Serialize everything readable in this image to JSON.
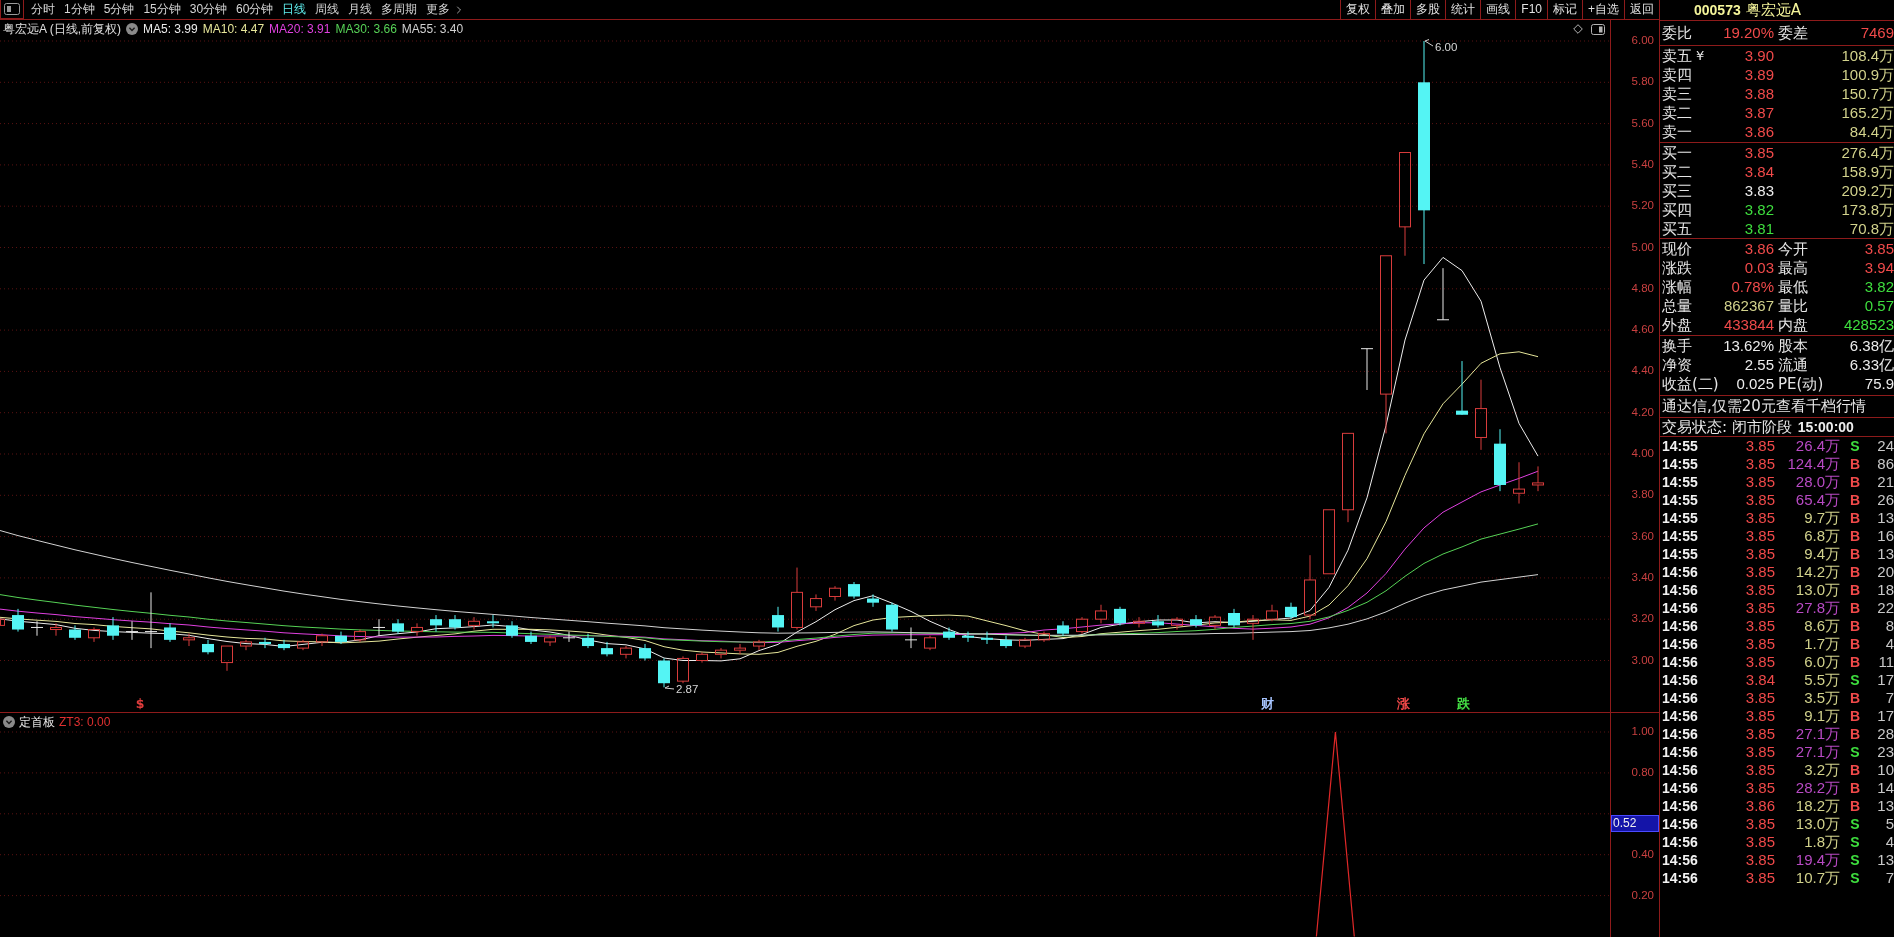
{
  "toolbar": {
    "periods": [
      {
        "label": "分时",
        "selected": false
      },
      {
        "label": "1分钟",
        "selected": false
      },
      {
        "label": "5分钟",
        "selected": false
      },
      {
        "label": "15分钟",
        "selected": false
      },
      {
        "label": "30分钟",
        "selected": false
      },
      {
        "label": "60分钟",
        "selected": false
      },
      {
        "label": "日线",
        "selected": true
      },
      {
        "label": "周线",
        "selected": false
      },
      {
        "label": "月线",
        "selected": false
      },
      {
        "label": "多周期",
        "selected": false
      }
    ],
    "more": {
      "label": "更多"
    },
    "tools": [
      "复权",
      "叠加",
      "多股",
      "统计",
      "画线",
      "F10",
      "标记",
      "+自选",
      "返回"
    ]
  },
  "chart": {
    "title": "粤宏远A (日线,前复权)",
    "moving_averages": [
      {
        "label": "MA5: 3.99",
        "color": "#ececec"
      },
      {
        "label": "MA10: 4.47",
        "color": "#e6e69a"
      },
      {
        "label": "MA20: 3.91",
        "color": "#e040e0"
      },
      {
        "label": "MA30: 3.66",
        "color": "#56d256"
      },
      {
        "label": "MA55: 3.40",
        "color": "#d2d2d2"
      }
    ],
    "price_axis": [
      "6.00",
      "5.80",
      "5.60",
      "5.40",
      "5.20",
      "5.00",
      "4.80",
      "4.60",
      "4.40",
      "4.20",
      "4.00",
      "3.80",
      "3.60",
      "3.40",
      "3.20",
      "3.00"
    ],
    "high_label": "6.00",
    "low_label": "2.87",
    "signals": [
      {
        "label": "$",
        "color": "#e03c3c"
      },
      {
        "label": "财",
        "color": "#a6c4ff"
      },
      {
        "label": "涨",
        "color": "#f04848"
      },
      {
        "label": "跌",
        "color": "#44e044"
      }
    ]
  },
  "indicator": {
    "name": "定首板",
    "reading": "ZT3: 0.00",
    "cursor_value": "0.52",
    "chart_data": {
      "type": "line",
      "categories": [
        null,
        null,
        null,
        null,
        null,
        null,
        null,
        null,
        null,
        null,
        null,
        null,
        null,
        null,
        null,
        null,
        null,
        null,
        null,
        null,
        null,
        null,
        null,
        null,
        null,
        null,
        null,
        null,
        null,
        null,
        null,
        null,
        null,
        null,
        null,
        null,
        null,
        null,
        null,
        null,
        null,
        null,
        null,
        null,
        null,
        null,
        null,
        null,
        null,
        null,
        null,
        null,
        null,
        null,
        null,
        null,
        null,
        null,
        null,
        null,
        null,
        null,
        null,
        null,
        null,
        null,
        null,
        null,
        null,
        null,
        null,
        null,
        null,
        null,
        null,
        null,
        null,
        null,
        null,
        null,
        null,
        null,
        null,
        null,
        null
      ],
      "series": [
        {
          "color": "#e02828",
          "values": [
            null,
            null,
            null,
            null,
            null,
            null,
            null,
            null,
            null,
            null,
            null,
            null,
            null,
            null,
            null,
            null,
            null,
            null,
            null,
            null,
            null,
            null,
            null,
            null,
            null,
            null,
            null,
            null,
            null,
            null,
            null,
            null,
            null,
            null,
            null,
            null,
            null,
            null,
            null,
            null,
            null,
            null,
            null,
            null,
            null,
            null,
            null,
            null,
            null,
            null,
            null,
            null,
            null,
            null,
            null,
            null,
            null,
            null,
            null,
            null,
            null,
            null,
            null,
            null,
            null,
            null,
            null,
            null,
            null,
            0,
            1,
            0,
            null,
            null,
            null,
            null,
            null,
            null,
            null,
            null,
            null,
            null,
            null,
            null,
            null
          ]
        }
      ],
      "ylim": [
        0,
        1
      ],
      "yticks": [
        {
          "value": 1,
          "label": "1.00"
        },
        {
          "value": 0.8,
          "label": "0.80"
        },
        {
          "value": 0.4,
          "label": "0.40"
        },
        {
          "value": 0.2,
          "label": "0.20"
        }
      ],
      "grid": true
    }
  },
  "quote": {
    "code": "000573",
    "name": "粤宏远A",
    "order_ratio": [
      {
        "label": "委比",
        "value": "19.20%",
        "color": "#f04a4a"
      },
      {
        "label": "委差",
        "value": "7469",
        "color": "#f04a4a"
      }
    ],
    "asks": [
      {
        "label": "卖五",
        "tag": "¥",
        "price": "3.90",
        "color": "#f04a4a",
        "volume": "108.4万"
      },
      {
        "label": "卖四",
        "price": "3.89",
        "color": "#f04a4a",
        "volume": "100.9万"
      },
      {
        "label": "卖三",
        "price": "3.88",
        "color": "#f04a4a",
        "volume": "150.7万"
      },
      {
        "label": "卖二",
        "price": "3.87",
        "color": "#f04a4a",
        "volume": "165.2万"
      },
      {
        "label": "卖一",
        "price": "3.86",
        "color": "#f04a4a",
        "volume": "84.4万"
      }
    ],
    "bids": [
      {
        "label": "买一",
        "price": "3.85",
        "color": "#f04a4a",
        "volume": "276.4万"
      },
      {
        "label": "买二",
        "price": "3.84",
        "color": "#f04a4a",
        "volume": "158.9万"
      },
      {
        "label": "买三",
        "price": "3.83",
        "color": "#ececec",
        "volume": "209.2万"
      },
      {
        "label": "买四",
        "price": "3.82",
        "color": "#3ede3e",
        "volume": "173.8万"
      },
      {
        "label": "买五",
        "price": "3.81",
        "color": "#3ede3e",
        "volume": "70.8万"
      }
    ],
    "stats": [
      {
        "label": "现价",
        "value": "3.86",
        "color": "#f04a4a"
      },
      {
        "label": "今开",
        "value": "3.85",
        "color": "#f04a4a"
      },
      {
        "label": "涨跌",
        "value": "0.03",
        "color": "#f04a4a"
      },
      {
        "label": "最高",
        "value": "3.94",
        "color": "#f04a4a"
      },
      {
        "label": "涨幅",
        "value": "0.78%",
        "color": "#f04a4a"
      },
      {
        "label": "最低",
        "value": "3.82",
        "color": "#3ede3e"
      },
      {
        "label": "总量",
        "value": "862367",
        "color": "#d2d28c"
      },
      {
        "label": "量比",
        "value": "0.57",
        "color": "#3ede3e"
      },
      {
        "label": "外盘",
        "value": "433844",
        "color": "#f04a4a"
      },
      {
        "label": "内盘",
        "value": "428523",
        "color": "#3ede3e"
      }
    ],
    "fundamentals": [
      {
        "label": "换手",
        "value": "13.62%",
        "color": "#ececec"
      },
      {
        "label": "股本",
        "value": "6.38亿",
        "color": "#ececec"
      },
      {
        "label": "净资",
        "value": "2.55",
        "color": "#ececec"
      },
      {
        "label": "流通",
        "value": "6.33亿",
        "color": "#ececec"
      },
      {
        "label": "收益(二)",
        "value": "0.025",
        "color": "#ececec"
      },
      {
        "label": "PE(动)",
        "value": "75.9",
        "color": "#ececec"
      }
    ],
    "notice": "通达信,仅需20元查看千档行情",
    "status": {
      "label": "交易状态: 闭市阶段",
      "time": "15:00:00"
    },
    "ticks": [
      {
        "time": "14:55",
        "price": "3.85",
        "color": "#f04a4a",
        "volume": "26.4万",
        "large": true,
        "side": "S",
        "kind": "sell",
        "count": "24"
      },
      {
        "time": "14:55",
        "price": "3.85",
        "color": "#f04a4a",
        "volume": "124.4万",
        "large": true,
        "side": "B",
        "kind": "buy",
        "count": "86"
      },
      {
        "time": "14:55",
        "price": "3.85",
        "color": "#f04a4a",
        "volume": "28.0万",
        "large": true,
        "side": "B",
        "kind": "buy",
        "count": "21"
      },
      {
        "time": "14:55",
        "price": "3.85",
        "color": "#f04a4a",
        "volume": "65.4万",
        "large": true,
        "side": "B",
        "kind": "buy",
        "count": "26"
      },
      {
        "time": "14:55",
        "price": "3.85",
        "color": "#f04a4a",
        "volume": "9.7万",
        "large": false,
        "side": "B",
        "kind": "buy",
        "count": "13"
      },
      {
        "time": "14:55",
        "price": "3.85",
        "color": "#f04a4a",
        "volume": "6.8万",
        "large": false,
        "side": "B",
        "kind": "buy",
        "count": "16"
      },
      {
        "time": "14:55",
        "price": "3.85",
        "color": "#f04a4a",
        "volume": "9.4万",
        "large": false,
        "side": "B",
        "kind": "buy",
        "count": "13"
      },
      {
        "time": "14:56",
        "price": "3.85",
        "color": "#f04a4a",
        "volume": "14.2万",
        "large": false,
        "side": "B",
        "kind": "buy",
        "count": "20"
      },
      {
        "time": "14:56",
        "price": "3.85",
        "color": "#f04a4a",
        "volume": "13.0万",
        "large": false,
        "side": "B",
        "kind": "buy",
        "count": "18"
      },
      {
        "time": "14:56",
        "price": "3.85",
        "color": "#f04a4a",
        "volume": "27.8万",
        "large": true,
        "side": "B",
        "kind": "buy",
        "count": "22"
      },
      {
        "time": "14:56",
        "price": "3.85",
        "color": "#f04a4a",
        "volume": "8.6万",
        "large": false,
        "side": "B",
        "kind": "buy",
        "count": "8"
      },
      {
        "time": "14:56",
        "price": "3.85",
        "color": "#f04a4a",
        "volume": "1.7万",
        "large": false,
        "side": "B",
        "kind": "buy",
        "count": "4"
      },
      {
        "time": "14:56",
        "price": "3.85",
        "color": "#f04a4a",
        "volume": "6.0万",
        "large": false,
        "side": "B",
        "kind": "buy",
        "count": "11"
      },
      {
        "time": "14:56",
        "price": "3.84",
        "color": "#f04a4a",
        "volume": "5.5万",
        "large": false,
        "side": "S",
        "kind": "sell",
        "count": "17"
      },
      {
        "time": "14:56",
        "price": "3.85",
        "color": "#f04a4a",
        "volume": "3.5万",
        "large": false,
        "side": "B",
        "kind": "buy",
        "count": "7"
      },
      {
        "time": "14:56",
        "price": "3.85",
        "color": "#f04a4a",
        "volume": "9.1万",
        "large": false,
        "side": "B",
        "kind": "buy",
        "count": "17"
      },
      {
        "time": "14:56",
        "price": "3.85",
        "color": "#f04a4a",
        "volume": "27.1万",
        "large": true,
        "side": "B",
        "kind": "buy",
        "count": "28"
      },
      {
        "time": "14:56",
        "price": "3.85",
        "color": "#f04a4a",
        "volume": "27.1万",
        "large": true,
        "side": "S",
        "kind": "sell",
        "count": "23"
      },
      {
        "time": "14:56",
        "price": "3.85",
        "color": "#f04a4a",
        "volume": "3.2万",
        "large": false,
        "side": "B",
        "kind": "buy",
        "count": "10"
      },
      {
        "time": "14:56",
        "price": "3.85",
        "color": "#f04a4a",
        "volume": "28.2万",
        "large": true,
        "side": "B",
        "kind": "buy",
        "count": "14"
      },
      {
        "time": "14:56",
        "price": "3.86",
        "color": "#f04a4a",
        "volume": "18.2万",
        "large": false,
        "side": "B",
        "kind": "buy",
        "count": "13"
      },
      {
        "time": "14:56",
        "price": "3.85",
        "color": "#f04a4a",
        "volume": "13.0万",
        "large": false,
        "side": "S",
        "kind": "sell",
        "count": "5"
      },
      {
        "time": "14:56",
        "price": "3.85",
        "color": "#f04a4a",
        "volume": "1.8万",
        "large": false,
        "side": "S",
        "kind": "sell",
        "count": "4"
      },
      {
        "time": "14:56",
        "price": "3.85",
        "color": "#f04a4a",
        "volume": "19.4万",
        "large": true,
        "side": "S",
        "kind": "sell",
        "count": "13"
      },
      {
        "time": "14:56",
        "price": "3.85",
        "color": "#f04a4a",
        "volume": "10.7万",
        "large": false,
        "side": "S",
        "kind": "sell",
        "count": "7"
      }
    ]
  }
}
